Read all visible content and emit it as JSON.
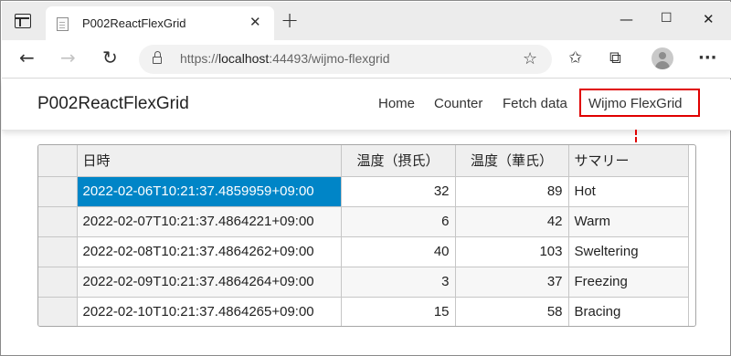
{
  "browser": {
    "tab_title": "P002ReactFlexGrid",
    "tab_close": "✕",
    "new_tab": "+",
    "url_scheme": "https://",
    "url_host": "localhost",
    "url_rest": ":44493/wijmo-flexgrid",
    "icons": [
      "tab-actions-icon",
      "page-icon",
      "close-icon",
      "plus-icon",
      "minimize-icon",
      "maximize-icon",
      "close-window-icon",
      "back-arrow-icon",
      "forward-arrow-icon",
      "refresh-icon",
      "lock-icon",
      "add-favorite-icon",
      "favorites-icon",
      "collections-icon",
      "profile-icon",
      "more-icon"
    ]
  },
  "app": {
    "brand": "P002ReactFlexGrid",
    "nav": {
      "home": "Home",
      "counter": "Counter",
      "fetch": "Fetch data",
      "flexgrid": "Wijmo FlexGrid"
    },
    "highlight_color": "#e00000"
  },
  "grid": {
    "columns": [
      "日時",
      "温度（摂氏）",
      "温度（華氏）",
      "サマリー"
    ],
    "rows": [
      {
        "date": "2022-02-06T10:21:37.4859959+09:00",
        "c": "32",
        "f": "89",
        "summary": "Hot"
      },
      {
        "date": "2022-02-07T10:21:37.4864221+09:00",
        "c": "6",
        "f": "42",
        "summary": "Warm"
      },
      {
        "date": "2022-02-08T10:21:37.4864262+09:00",
        "c": "40",
        "f": "103",
        "summary": "Sweltering"
      },
      {
        "date": "2022-02-09T10:21:37.4864264+09:00",
        "c": "3",
        "f": "37",
        "summary": "Freezing"
      },
      {
        "date": "2022-02-10T10:21:37.4864265+09:00",
        "c": "15",
        "f": "58",
        "summary": "Bracing"
      }
    ],
    "selected_color": "#0085c7"
  }
}
